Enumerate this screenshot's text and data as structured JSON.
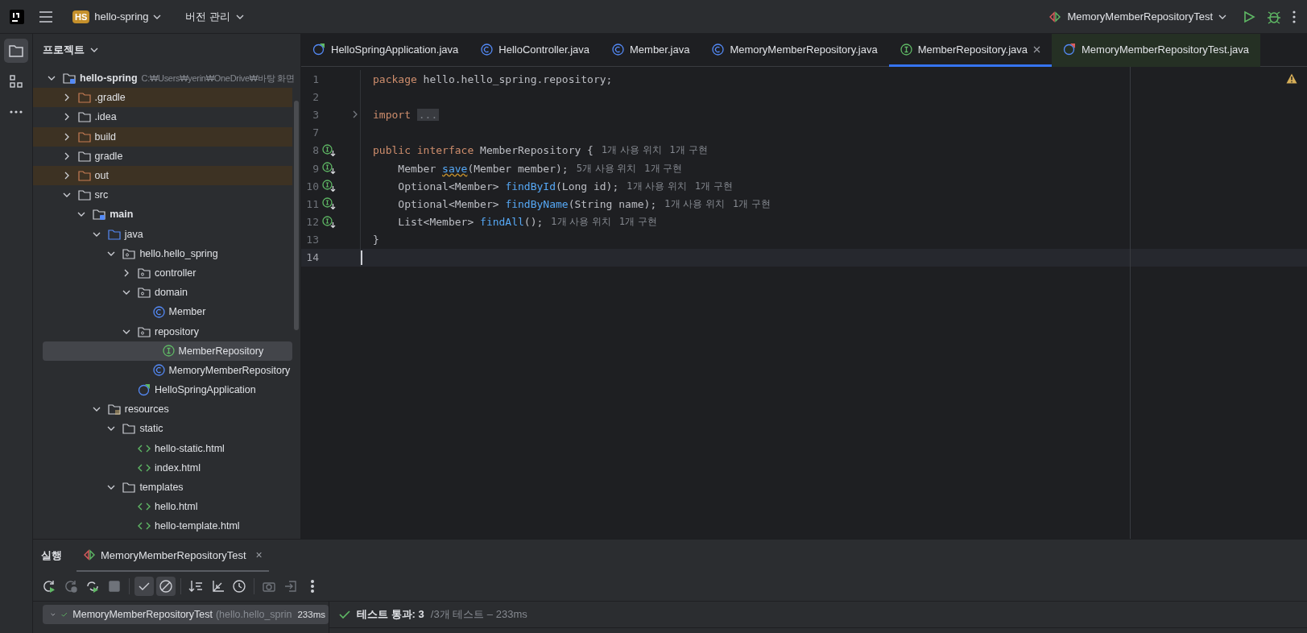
{
  "title_bar": {
    "project_badge": "HS",
    "project": "hello-spring",
    "vcs": "버전 관리",
    "run_config": "MemoryMemberRepositoryTest"
  },
  "project_panel": {
    "title": "프로젝트",
    "tree": [
      {
        "label": "hello-spring",
        "kind": "module",
        "path": "C:₩Users₩yerin₩OneDrive₩바탕 화면",
        "selected": false,
        "expanded": true,
        "children": [
          {
            "label": ".gradle",
            "kind": "excluded",
            "selected": false,
            "expanded": false
          },
          {
            "label": ".idea",
            "kind": "folder",
            "selected": false,
            "expanded": false
          },
          {
            "label": "build",
            "kind": "excluded",
            "selected": false,
            "expanded": false
          },
          {
            "label": "gradle",
            "kind": "folder",
            "selected": false,
            "expanded": false
          },
          {
            "label": "out",
            "kind": "excluded",
            "selected": false,
            "expanded": false
          },
          {
            "label": "src",
            "kind": "folder",
            "selected": false,
            "expanded": true,
            "children": [
              {
                "label": "main",
                "kind": "module",
                "selected": false,
                "expanded": true,
                "children": [
                  {
                    "label": "java",
                    "kind": "source",
                    "selected": false,
                    "expanded": true,
                    "children": [
                      {
                        "label": "hello.hello_spring",
                        "kind": "package",
                        "selected": false,
                        "expanded": true,
                        "children": [
                          {
                            "label": "controller",
                            "kind": "package",
                            "selected": false,
                            "expanded": false
                          },
                          {
                            "label": "domain",
                            "kind": "package",
                            "selected": false,
                            "expanded": true,
                            "children": [
                              {
                                "label": "Member",
                                "kind": "class",
                                "selected": false
                              }
                            ]
                          },
                          {
                            "label": "repository",
                            "kind": "package",
                            "selected": false,
                            "expanded": true,
                            "children": [
                              {
                                "label": "MemberRepository",
                                "kind": "interface",
                                "selected": true
                              },
                              {
                                "label": "MemoryMemberRepository",
                                "kind": "class",
                                "selected": false
                              }
                            ]
                          },
                          {
                            "label": "HelloSpringApplication",
                            "kind": "app",
                            "selected": false
                          }
                        ]
                      }
                    ]
                  },
                  {
                    "label": "resources",
                    "kind": "resources",
                    "selected": false,
                    "expanded": true,
                    "children": [
                      {
                        "label": "static",
                        "kind": "folder",
                        "selected": false,
                        "expanded": true,
                        "children": [
                          {
                            "label": "hello-static.html",
                            "kind": "html",
                            "selected": false
                          },
                          {
                            "label": "index.html",
                            "kind": "html",
                            "selected": false
                          }
                        ]
                      },
                      {
                        "label": "templates",
                        "kind": "folder",
                        "selected": false,
                        "expanded": true,
                        "children": [
                          {
                            "label": "hello.html",
                            "kind": "html",
                            "selected": false
                          },
                          {
                            "label": "hello-template.html",
                            "kind": "html",
                            "selected": false
                          }
                        ]
                      }
                    ]
                  }
                ]
              }
            ]
          }
        ]
      }
    ]
  },
  "editor_tabs": [
    {
      "label": "HelloSpringApplication.java",
      "kind": "app",
      "selected": false
    },
    {
      "label": "HelloController.java",
      "kind": "class",
      "selected": false
    },
    {
      "label": "Member.java",
      "kind": "class",
      "selected": false
    },
    {
      "label": "MemoryMemberRepository.java",
      "kind": "class",
      "selected": false
    },
    {
      "label": "MemberRepository.java",
      "kind": "interface",
      "selected": true
    },
    {
      "label": "MemoryMemberRepositoryTest.java",
      "kind": "test",
      "selected": false
    }
  ],
  "code_lines": [
    {
      "number": "1",
      "gutter": false,
      "folded": false,
      "current": false,
      "tokens": [
        {
          "kind": "keyword",
          "text": "package"
        },
        {
          "kind": "plain",
          "text": " hello.hello_spring.repository;"
        }
      ]
    },
    {
      "number": "2",
      "gutter": false,
      "folded": false,
      "current": false
    },
    {
      "number": "3",
      "gutter": false,
      "folded": true,
      "current": false,
      "tokens": [
        {
          "kind": "keyword",
          "text": "import"
        },
        {
          "kind": "fold",
          "text": "..."
        }
      ]
    },
    {
      "number": "7",
      "gutter": false,
      "folded": false,
      "current": false
    },
    {
      "number": "8",
      "gutter": true,
      "folded": false,
      "current": false,
      "tokens": [
        {
          "kind": "keyword",
          "text": "public interface"
        },
        {
          "kind": "plain",
          "text": " MemberRepository {"
        },
        {
          "kind": "hint",
          "text": "1개 사용 위치"
        },
        {
          "kind": "hint",
          "text": "1개 구현"
        }
      ]
    },
    {
      "number": "9",
      "gutter": true,
      "folded": false,
      "current": false,
      "tokens": [
        {
          "kind": "plain",
          "text": "    Member "
        },
        {
          "kind": "method-warning",
          "text": "save"
        },
        {
          "kind": "plain",
          "text": "(Member member);"
        },
        {
          "kind": "hint",
          "text": "5개 사용 위치"
        },
        {
          "kind": "hint",
          "text": "1개 구현"
        }
      ]
    },
    {
      "number": "10",
      "gutter": true,
      "folded": false,
      "current": false,
      "tokens": [
        {
          "kind": "plain",
          "text": "    Optional<Member> "
        },
        {
          "kind": "method",
          "text": "findById"
        },
        {
          "kind": "plain",
          "text": "(Long id);"
        },
        {
          "kind": "hint",
          "text": "1개 사용 위치"
        },
        {
          "kind": "hint",
          "text": "1개 구현"
        }
      ]
    },
    {
      "number": "11",
      "gutter": true,
      "folded": false,
      "current": false,
      "tokens": [
        {
          "kind": "plain",
          "text": "    Optional<Member> "
        },
        {
          "kind": "method",
          "text": "findByName"
        },
        {
          "kind": "plain",
          "text": "(String name);"
        },
        {
          "kind": "hint",
          "text": "1개 사용 위치"
        },
        {
          "kind": "hint",
          "text": "1개 구현"
        }
      ]
    },
    {
      "number": "12",
      "gutter": true,
      "folded": false,
      "current": false,
      "tokens": [
        {
          "kind": "plain",
          "text": "    List<Member> "
        },
        {
          "kind": "method",
          "text": "findAll"
        },
        {
          "kind": "plain",
          "text": "();"
        },
        {
          "kind": "hint",
          "text": "1개 사용 위치"
        },
        {
          "kind": "hint",
          "text": "1개 구현"
        }
      ]
    },
    {
      "number": "13",
      "gutter": false,
      "folded": false,
      "current": false,
      "tokens": [
        {
          "kind": "plain",
          "text": "}"
        }
      ]
    },
    {
      "number": "14",
      "gutter": false,
      "folded": false,
      "current": true
    }
  ],
  "run_panel": {
    "title": "실행",
    "tab": "MemoryMemberRepositoryTest",
    "close": "×",
    "toolbar": [
      {
        "kind": "rerun",
        "disabled": false,
        "on": false
      },
      {
        "kind": "rerun-failed",
        "disabled": true,
        "on": false
      },
      {
        "kind": "toggle-auto",
        "disabled": false,
        "on": false
      },
      {
        "kind": "stop",
        "disabled": true,
        "on": false
      },
      {
        "kind": "sep"
      },
      {
        "kind": "check",
        "disabled": false,
        "on": true
      },
      {
        "kind": "ignored",
        "disabled": false,
        "on": true
      },
      {
        "kind": "sep"
      },
      {
        "kind": "sort",
        "disabled": false,
        "on": false
      },
      {
        "kind": "collapse",
        "disabled": false,
        "on": false
      },
      {
        "kind": "history",
        "disabled": false,
        "on": false
      },
      {
        "kind": "sep"
      },
      {
        "kind": "camera",
        "disabled": true,
        "on": false
      },
      {
        "kind": "export",
        "disabled": true,
        "on": false
      },
      {
        "kind": "more",
        "disabled": false,
        "on": false
      }
    ],
    "test": {
      "name": "MemoryMemberRepositoryTest",
      "package": "(hello.hello_sprin",
      "time": "233ms",
      "selected": true
    },
    "summary": {
      "status": "테스트 통과: 3",
      "detail": "/3개 테스트 – 233ms"
    }
  }
}
